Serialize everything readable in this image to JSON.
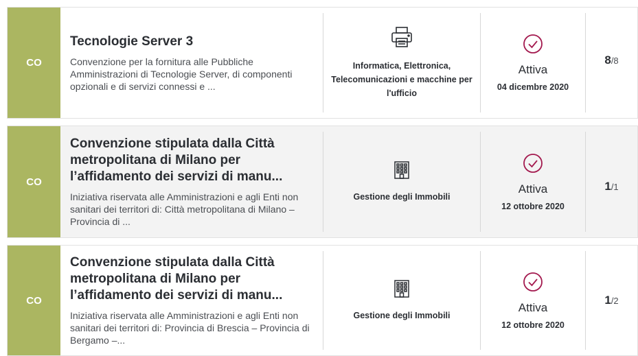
{
  "items": [
    {
      "badge": "CO",
      "title": "Tecnologie Server 3",
      "description": "Convenzione per la fornitura alle Pubbliche Amministrazioni di Tecnologie Server, di componenti opzionali e di servizi connessi e ...",
      "category": "Informatica, Elettronica, Telecomunicazioni e macchine per l'ufficio",
      "category_icon": "printer-icon",
      "status": "Attiva",
      "date": "04 dicembre 2020",
      "lot_current": "8",
      "lot_total": "/8"
    },
    {
      "badge": "CO",
      "title": "Convenzione stipulata dalla Città metropolitana di Milano per l’affidamento dei servizi di manu...",
      "description": "Iniziativa riservata alle Amministrazioni e agli Enti non sanitari dei territori di: Città metropolitana di Milano – Provincia di ...",
      "category": "Gestione degli Immobili",
      "category_icon": "building-icon",
      "status": "Attiva",
      "date": "12 ottobre 2020",
      "lot_current": "1",
      "lot_total": "/1"
    },
    {
      "badge": "CO",
      "title": "Convenzione stipulata dalla Città metropolitana di Milano per l’affidamento dei servizi di manu...",
      "description": "Iniziativa riservata alle Amministrazioni e agli Enti non sanitari dei territori di: Provincia di Brescia – Provincia di Bergamo –...",
      "category": "Gestione degli Immobili",
      "category_icon": "building-icon",
      "status": "Attiva",
      "date": "12 ottobre 2020",
      "lot_current": "1",
      "lot_total": "/2"
    }
  ],
  "colors": {
    "badge_bg": "#abb661",
    "status_icon": "#a3194e",
    "card_alt_bg": "#f3f3f3"
  }
}
